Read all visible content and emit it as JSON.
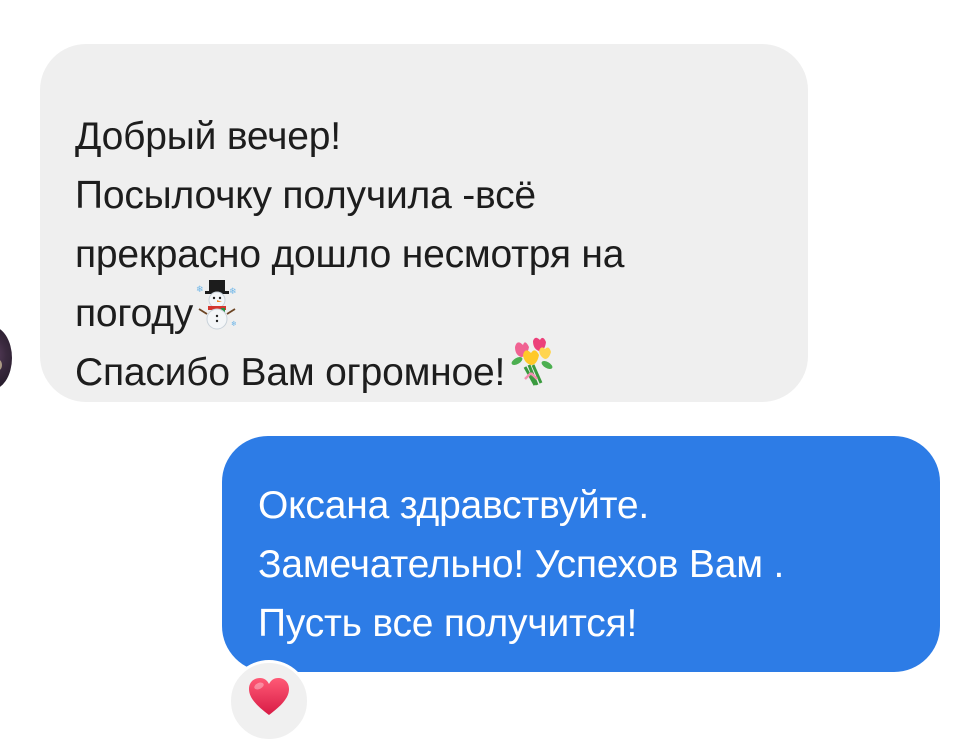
{
  "incoming_message": {
    "lines": [
      "Добрый вечер!",
      "Посылочку получила -всё",
      "прекрасно дошло несмотря на",
      "погоду",
      "Спасибо Вам огромное!"
    ],
    "emoji_after_line_4": "snowman-icon",
    "emoji_after_line_5": "bouquet-icon"
  },
  "outgoing_message": {
    "lines": [
      "Оксана здравствуйте.",
      "Замечательно! Успехов Вам .",
      "Пусть все получится!"
    ]
  },
  "reaction": {
    "icon": "heart-icon",
    "color": "#e8294f"
  },
  "colors": {
    "incoming_bubble": "#efefef",
    "outgoing_bubble": "#2d7ce6"
  }
}
